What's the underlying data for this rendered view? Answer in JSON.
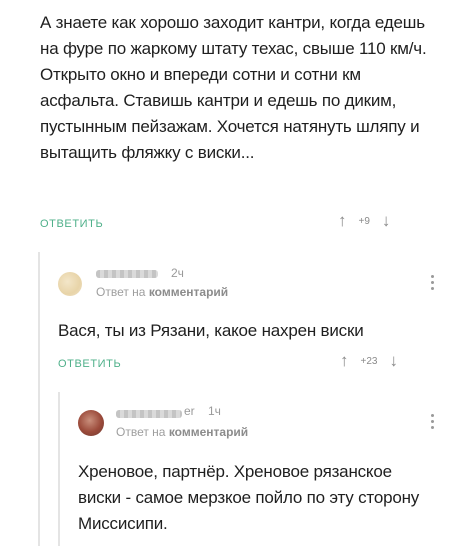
{
  "comments": [
    {
      "text": "А знаете как хорошо заходит кантри, когда едешь на фуре по жаркому штату техас, свыше 110 км/ч. Открыто окно и впереди сотни и сотни км асфальта. Ставишь кантри и едешь по диким, пустынным пейзажам. Хочется натянуть шляпу и вытащить фляжку с виски...",
      "reply_label": "ОТВЕТИТЬ",
      "score": "+9"
    },
    {
      "time": "2ч",
      "reply_to_prefix": "Ответ на",
      "reply_to_target": "комментарий",
      "text": "Вася, ты из Рязани, какое нахрен виски",
      "reply_label": "ОТВЕТИТЬ",
      "score": "+23"
    },
    {
      "author_fragment": "er",
      "time": "1ч",
      "reply_to_prefix": "Ответ на",
      "reply_to_target": "комментарий",
      "text": "Хреновое, партнёр. Хреновое рязанское виски - самое мерзкое пойло по эту сторону Миссисипи."
    }
  ],
  "icons": {
    "upvote": "up-arrow-icon",
    "downvote": "down-arrow-icon",
    "more": "vertical-dots-icon"
  },
  "colors": {
    "accent": "#4fb08a",
    "muted": "#9a9a9a",
    "thread": "#e4e4e4"
  }
}
